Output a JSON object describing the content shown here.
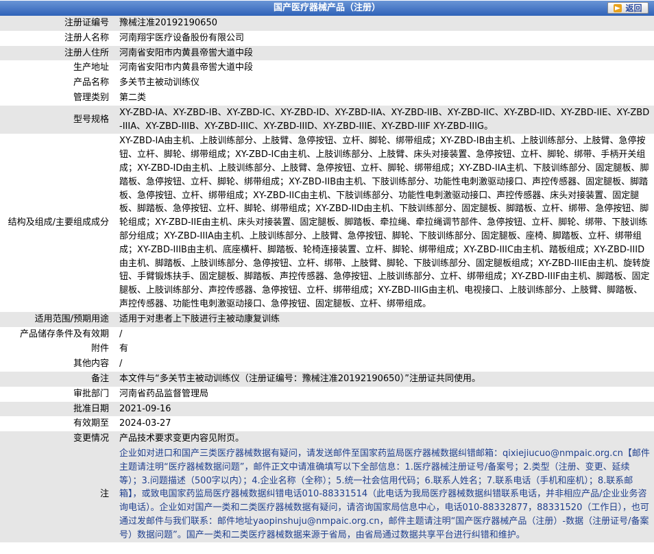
{
  "header": {
    "title": "国产医疗器械产品（注册）",
    "back_label": "返回"
  },
  "rows": [
    {
      "label": "注册证编号",
      "value": "豫械注准20192190650"
    },
    {
      "label": "注册人名称",
      "value": "河南翔宇医疗设备股份有限公司"
    },
    {
      "label": "注册人住所",
      "value": "河南省安阳市内黄县帝喾大道中段"
    },
    {
      "label": "生产地址",
      "value": "河南省安阳市内黄县帝喾大道中段"
    },
    {
      "label": "产品名称",
      "value": "多关节主被动训练仪"
    },
    {
      "label": "管理类别",
      "value": "第二类"
    },
    {
      "label": "型号规格",
      "value": "XY-ZBD-IA、XY-ZBD-IB、XY-ZBD-IC、XY-ZBD-ID、XY-ZBD-IIA、XY-ZBD-IIB、XY-ZBD-IIC、XY-ZBD-IID、XY-ZBD-IIE、XY-ZBD-IIIA、XY-ZBD-IIIB、XY-ZBD-IIIC、XY-ZBD-IIID、XY-ZBD-IIIE、XY-ZBD-IIIF XY-ZBD-IIIG。"
    },
    {
      "label": "结构及组成/主要组成成分",
      "value": "XY-ZBD-IA由主机、上肢训练部分、上肢臂、急停按钮、立杆、脚轮、绑带组成；XY-ZBD-IB由主机、上肢训练部分、上肢臂、急停按钮、立杆、脚轮、绑带组成；XY-ZBD-IC由主机、上肢训练部分、上肢臂、床头对接装置、急停按钮、立杆、脚轮、绑带、手柄开关组成；XY-ZBD-ID由主机、上肢训练部分、上肢臂、急停按钮、立杆、脚轮、绑带组成；XY-ZBD-IIA主机、下肢训练部分、固定腿板、脚踏板、急停按钮、立杆、脚轮、绑带组成；XY-ZBD-IIB由主机、下肢训练部分、功能性电刺激驱动接口、声控传感器、固定腿板、脚踏板、急停按钮、立杆、绑带组成；XY-ZBD-IIC由主机、下肢训练部分、功能性电刺激驱动接口、声控传感器、床头对接装置、固定腿板、脚踏板、急停按钮、立杆、脚轮、绑带组成；XY-ZBD-IID由主机、下肢训练部分、固定腿板、脚踏板、立杆、绑带、急停按钮、脚轮组成；XY-ZBD-IIE由主机、床头对接装置、固定腿板、脚踏板、牵拉绳、牵拉绳调节部件、急停按钮、立杆、脚轮、绑带、下肢训练部分组成；XY-ZBD-IIIA由主机、上肢训练部分、上肢臂、急停按钮、脚轮、下肢训练部分、固定腿板、座椅、脚踏板、立杆、绑带组成；XY-ZBD-IIIB由主机、底座横杆、脚踏板、轮椅连接装置、立杆、脚轮、绑带组成；XY-ZBD-IIIC由主机、踏板组成；XY-ZBD-IIID由主机、脚踏板、上肢训练部分、急停按钮、立杆、绑带、上肢臂、脚轮、下肢训练部分、固定腿板组成；XY-ZBD-IIIE由主机、旋转旋钮、手臂锻炼扶手、固定腿板、脚踏板、声控传感器、急停按钮、上肢训练部分、立杆、绑带组成；XY-ZBD-IIIF由主机、脚踏板、固定腿板、上肢训练部分、声控传感器、急停按钮、立杆、绑带组成；XY-ZBD-IIIG由主机、电视接口、上肢训练部分、上肢臂、脚踏板、声控传感器、功能性电刺激驱动接口、急停按钮、固定腿板、立杆、绑带组成。"
    },
    {
      "label": "适用范围/预期用途",
      "value": "适用于对患者上下肢进行主被动康复训练"
    },
    {
      "label": "产品储存条件及有效期",
      "value": "/"
    },
    {
      "label": "附件",
      "value": "有"
    },
    {
      "label": "其他内容",
      "value": "/"
    },
    {
      "label": "备注",
      "value": "本文件与“多关节主被动训练仪（注册证编号：豫械注准20192190650）”注册证共同使用。"
    },
    {
      "label": "审批部门",
      "value": "河南省药品监督管理局"
    },
    {
      "label": "批准日期",
      "value": "2021-09-16"
    },
    {
      "label": "有效期至",
      "value": "2024-03-27"
    },
    {
      "label": "变更情况",
      "value": "产品技术要求变更内容见附页。"
    },
    {
      "label": "注",
      "value": "企业如对进口和国产三类医疗器械数据有疑问，请发送邮件至国家药监局医疗器械数据纠错邮箱：qixiejiucuo@nmpaic.org.cn【邮件主题请注明“医疗器械数据问题”，邮件正文中请准确填写以下全部信息：1.医疗器械注册证号/备案号；2.类型（注册、变更、延续等）；3.问题描述（500字以内）；4.企业名称（全称）；5.统一社会信用代码；6.联系人姓名；7.联系电话（手机和座机）；8.联系邮箱】，或致电国家药监局医疗器械数据纠错电话010-88331514（此电话为我局医疗器械数据纠错联系电话，并非相应产品/企业业务咨询电话）。企业如对国产一类和二类医疗器械数据有疑问，请咨询国家局信息中心，电话010-88332877，88331520（工作日），也可通过发邮件与我们联系：邮件地址yaopinshuju@nmpaic.org.cn，邮件主题请注明“国产医疗器械产品（注册）-数据（注册证号/备案号）数据问题”。国产一类和二类医疗器械数据来源于省局，由省局通过数据共享平台进行纠错和维护。"
    }
  ]
}
